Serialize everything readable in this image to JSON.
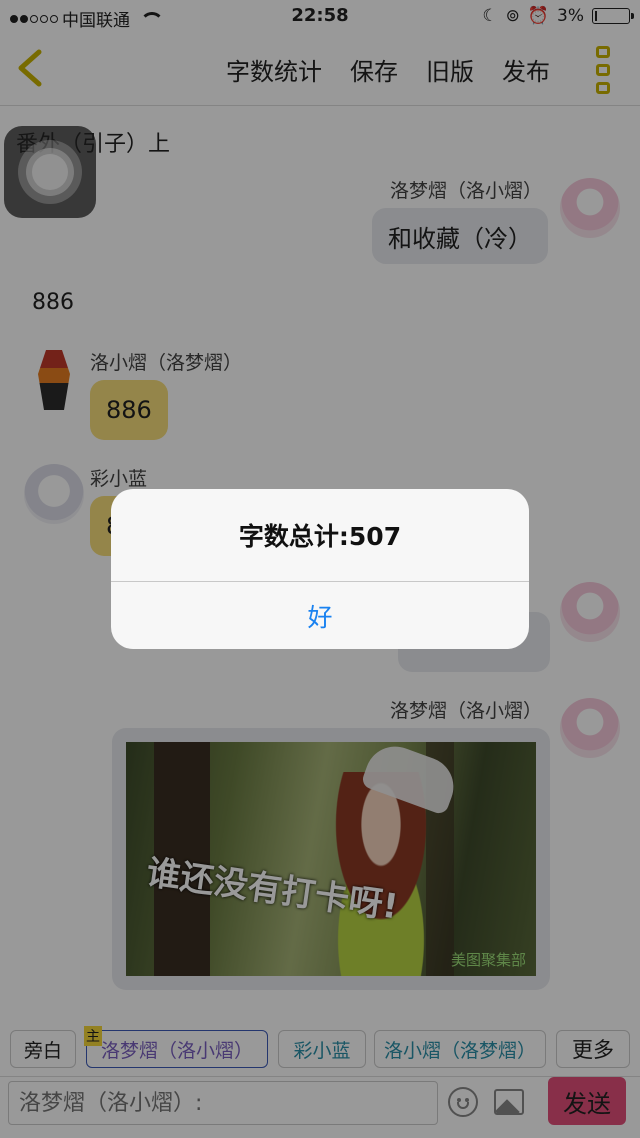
{
  "status_bar": {
    "carrier": "中国联通",
    "time": "22:58",
    "battery": "3%"
  },
  "nav": {
    "actions": [
      "字数统计",
      "保存",
      "旧版",
      "发布"
    ]
  },
  "chapter_title": "番外（引子）上",
  "messages": [
    {
      "name": "洛梦熠（洛小熠）",
      "text": "和收藏（冷）"
    },
    {
      "narration": "886"
    },
    {
      "name": "洛小熠（洛梦熠）",
      "text": "886"
    },
    {
      "name": "彩小蓝",
      "text": "8"
    },
    {
      "name": "",
      "text": ""
    },
    {
      "name": "洛梦熠（洛小熠）",
      "image_caption": "谁还没有打卡呀!",
      "image_watermark": "美图聚集部"
    }
  ],
  "roles": {
    "narration": "旁白",
    "host_tag": "主",
    "active": "洛梦熠（洛小熠）",
    "r2": "彩小蓝",
    "r3": "洛小熠（洛梦熠）",
    "more": "更多"
  },
  "input": {
    "placeholder": "洛梦熠（洛小熠）:",
    "send": "发送"
  },
  "alert": {
    "message": "字数总计:507",
    "ok": "好"
  },
  "colors": {
    "accent_yellow": "#c9b300",
    "send": "#e34f7a",
    "alert_button": "#1a82f0"
  }
}
